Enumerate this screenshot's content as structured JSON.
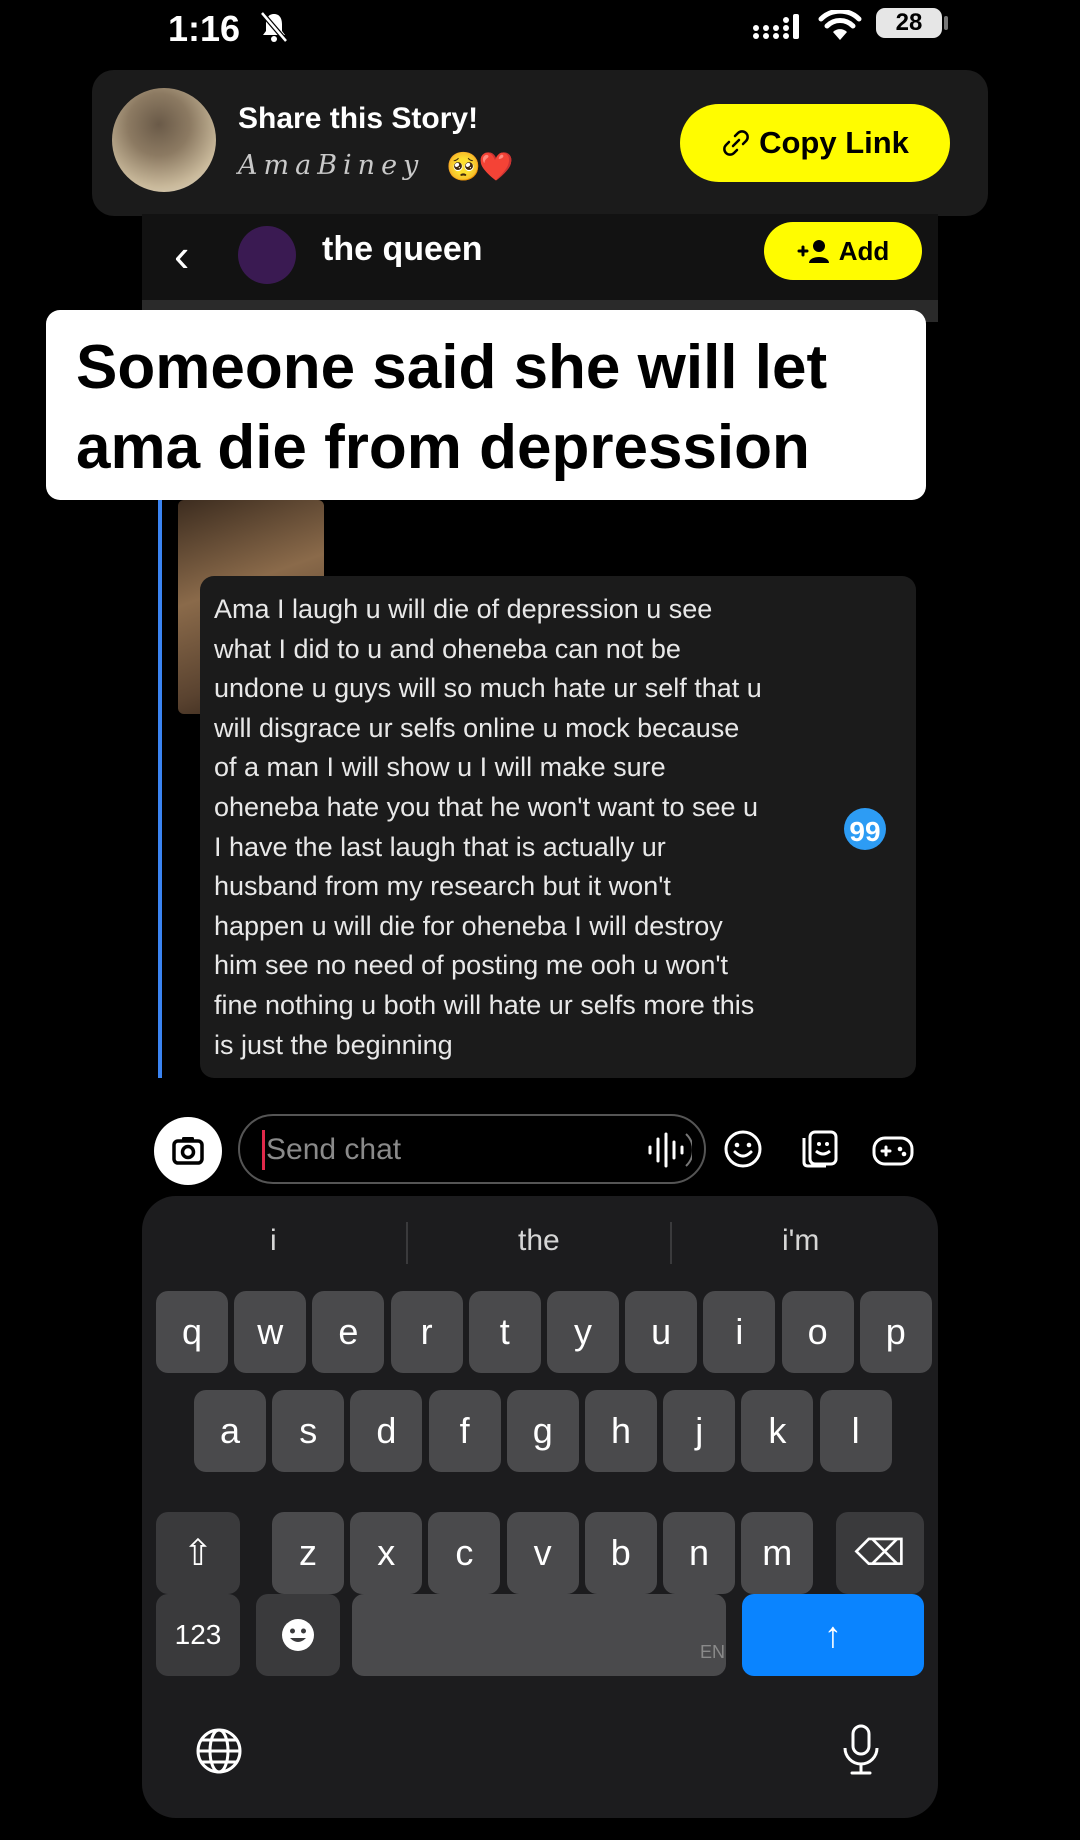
{
  "status_bar": {
    "time": "1:16",
    "battery": "28"
  },
  "share_banner": {
    "title": "Share this Story!",
    "username": "AmaBiney",
    "emoji": "🥺❤️",
    "copy_link_label": "Copy Link"
  },
  "chat_header": {
    "back_glyph": "‹",
    "name": "the queen",
    "add_label": "Add"
  },
  "caption": "Someone said she will let ama die from depression",
  "message": {
    "lines": [
      "Ama I laugh u will die of depression u see",
      "what I did to u and oheneba can not be",
      "undone u guys will so much hate ur self that u",
      "will disgrace ur selfs online u mock because",
      "of a man I will show u I will make sure",
      "oheneba hate you that he won't want to see u",
      "I have the last laugh that is actually ur",
      "husband from my research but it won't",
      "happen u will die for oheneba I will destroy",
      "him see no need of posting me ooh u won't",
      "fine nothing u both will hate ur selfs more this",
      "is just the beginning"
    ],
    "badge": "99"
  },
  "chat_input": {
    "placeholder": "Send chat",
    "value": ""
  },
  "keyboard": {
    "suggestions": [
      "i",
      "the",
      "i'm"
    ],
    "row1": [
      "q",
      "w",
      "e",
      "r",
      "t",
      "y",
      "u",
      "i",
      "o",
      "p"
    ],
    "row2": [
      "a",
      "s",
      "d",
      "f",
      "g",
      "h",
      "j",
      "k",
      "l"
    ],
    "row3": [
      "z",
      "x",
      "c",
      "v",
      "b",
      "n",
      "m"
    ],
    "numbers_label": "123",
    "space_language": "EN",
    "shift_glyph": "⇧",
    "backspace_glyph": "⌫",
    "send_glyph": "↑"
  },
  "colors": {
    "snap_yellow": "#fffc00",
    "reply_blue": "#3b84f2",
    "send_blue": "#0a84ff"
  }
}
